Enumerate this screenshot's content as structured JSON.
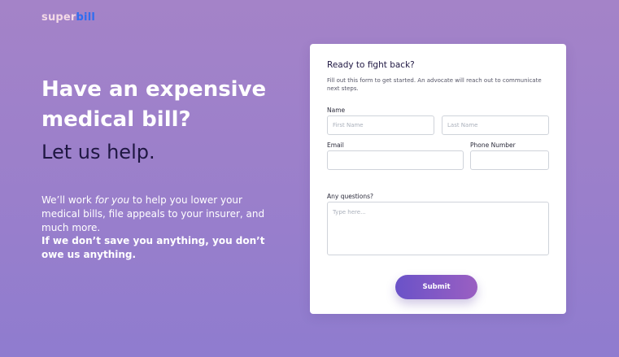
{
  "brand": {
    "part1": "super",
    "part2": "bill"
  },
  "hero": {
    "title": "Have an expensive medical bill?",
    "subtitle": "Let us help.",
    "body_before": "We’ll work ",
    "body_emphasis": "for you",
    "body_after": " to help you lower your medical bills, file appeals to your insurer, and much more.",
    "body_strong": "If we don’t save you anything, you don’t owe us anything."
  },
  "form": {
    "title": "Ready to fight back?",
    "description": "Fill out this form to get started. An advocate will reach out to communicate next steps.",
    "name_label": "Name",
    "first_name_placeholder": "First Name",
    "last_name_placeholder": "Last Name",
    "email_label": "Email",
    "phone_label": "Phone Number",
    "questions_label": "Any questions?",
    "questions_placeholder": "Type here...",
    "submit_label": "Submit"
  }
}
